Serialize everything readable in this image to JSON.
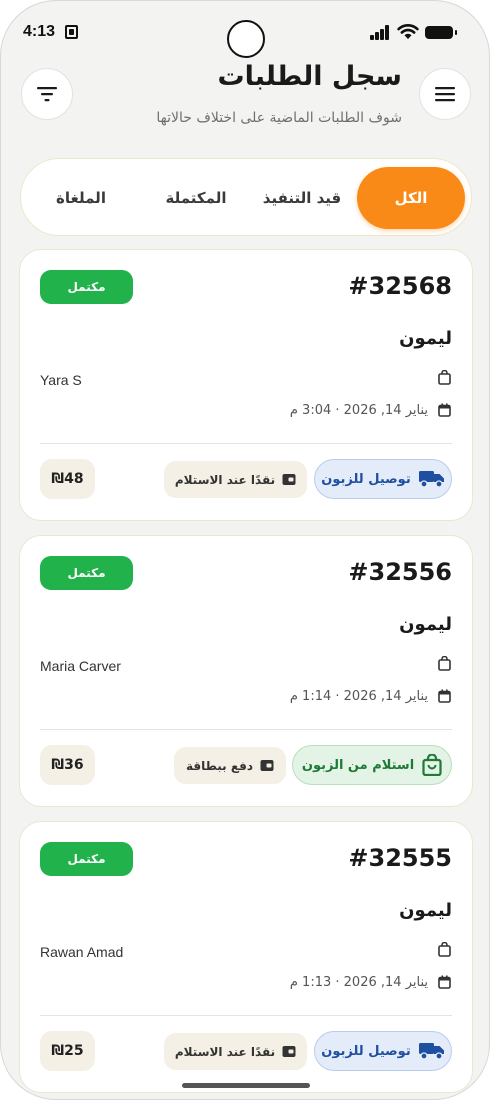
{
  "status_bar": {
    "time": "4:13"
  },
  "header": {
    "title": "سجل الطلبات",
    "subtitle": "شوف الطلبات الماضية على اختلاف حالاتها"
  },
  "tabs": [
    {
      "label": "الكل",
      "active": true
    },
    {
      "label": "قيد التنفيذ",
      "active": false
    },
    {
      "label": "المكتملة",
      "active": false
    },
    {
      "label": "الملغاة",
      "active": false
    }
  ],
  "orders": [
    {
      "status": "مكتمل",
      "number": "#32568",
      "merchant": "ليمون",
      "customer": "Yara S",
      "date": "يناير 14, 2026 · 3:04 م",
      "price": "₪48",
      "payment": "نقدًا عند الاستلام",
      "delivery": "توصيل للزبون",
      "delivery_type": "delivery"
    },
    {
      "status": "مكتمل",
      "number": "#32556",
      "merchant": "ليمون",
      "customer": "Maria Carver",
      "date": "يناير 14, 2026 · 1:14 م",
      "price": "₪36",
      "payment": "دفع ببطاقة",
      "delivery": "استلام من الزبون",
      "delivery_type": "pickup"
    },
    {
      "status": "مكتمل",
      "number": "#32555",
      "merchant": "ليمون",
      "customer": "Rawan Amad",
      "date": "يناير 14, 2026 · 1:13 م",
      "price": "₪25",
      "payment": "نقدًا عند الاستلام",
      "delivery": "توصيل للزبون",
      "delivery_type": "delivery"
    }
  ],
  "colors": {
    "accent": "#f98a18",
    "badge_green": "#21b24b",
    "delivery_blue": "#1f4fa0",
    "pickup_green": "#1f7a36"
  }
}
